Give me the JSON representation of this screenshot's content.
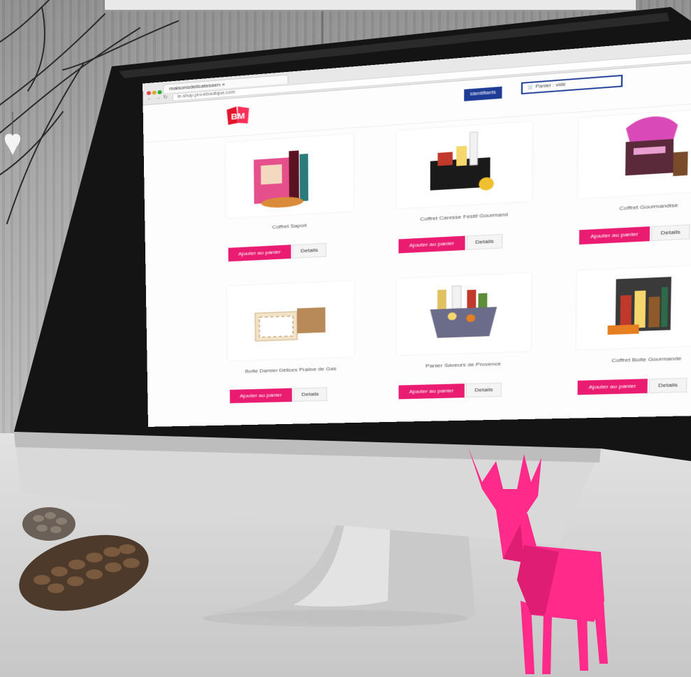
{
  "browser": {
    "tab_title": "maisonsdelicatessen ×",
    "url": "le-shop.pro-eboutique.com",
    "nav_back": "←",
    "nav_forward": "→",
    "nav_reload": "↻",
    "menu_icon": "≡"
  },
  "header": {
    "logo_text": "BM",
    "login_label": "Identifiants",
    "cart_label": "Panier : vide",
    "cart_icon": "cart-icon"
  },
  "products": [
    {
      "name": "Coffret Sapori",
      "add_label": "Ajouter au panier",
      "details_label": "Details"
    },
    {
      "name": "Coffret Caresse Festif Gourmand",
      "add_label": "Ajouter au panier",
      "details_label": "Details"
    },
    {
      "name": "Coffret Gourmandise",
      "add_label": "Ajouter au panier",
      "details_label": "Details"
    },
    {
      "name": "Boîte Damier Délices Praline de Gas",
      "add_label": "Ajouter au panier",
      "details_label": "Details"
    },
    {
      "name": "Panier Saveurs de Provence",
      "add_label": "Ajouter au panier",
      "details_label": "Details"
    },
    {
      "name": "Coffret Boite Gourmande",
      "add_label": "Ajouter au panier",
      "details_label": "Details"
    }
  ],
  "colors": {
    "accent_pink": "#ea1c72",
    "brand_blue": "#1e3c96",
    "deer_pink": "#ff2a8a"
  }
}
